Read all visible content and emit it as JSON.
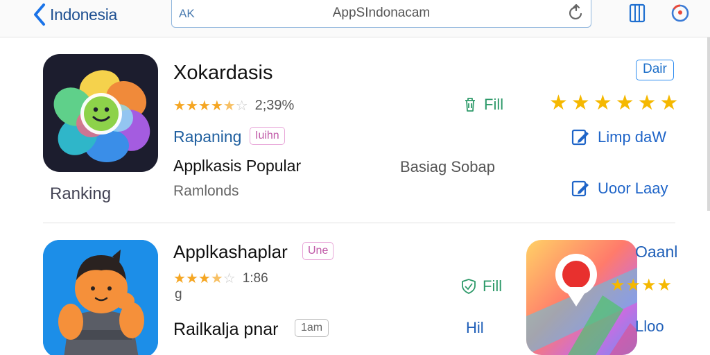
{
  "topbar": {
    "back_label": "Indonesia",
    "url_aa": "AK",
    "url_text": "AppSIndonacam"
  },
  "app1": {
    "title": "Xokardasis",
    "stars": [
      "full",
      "full",
      "full",
      "full",
      "half",
      "empty"
    ],
    "rating_text": "2;39%",
    "category": "Rapaning",
    "pink_tag": "Iuihn",
    "subtitle": "Applkasis Popular",
    "meta": "Ramlonds",
    "ranking_label": "Ranking",
    "green_action": "Fill",
    "mid_text": "Basiag Sobap",
    "button": "Dair",
    "big_stars": 6,
    "link1": "Limp daW",
    "link2": "Uoor Laay"
  },
  "app2": {
    "title": "Applkashaplar",
    "pink_tag": "Une",
    "stars": [
      "full",
      "full",
      "full",
      "half",
      "empty"
    ],
    "rating_text": "1:86",
    "rating_sub": "g",
    "subtitle": "Railkalja pnar",
    "gray_tag": "1am",
    "green_action": "Fill",
    "blue_action": "Hil",
    "right_title": "Oaanl",
    "right_stars": 4,
    "right_label": "Lloo"
  },
  "colors": {
    "accent": "#1a73e8",
    "star": "#f5a623",
    "green": "#2e9a6a"
  }
}
